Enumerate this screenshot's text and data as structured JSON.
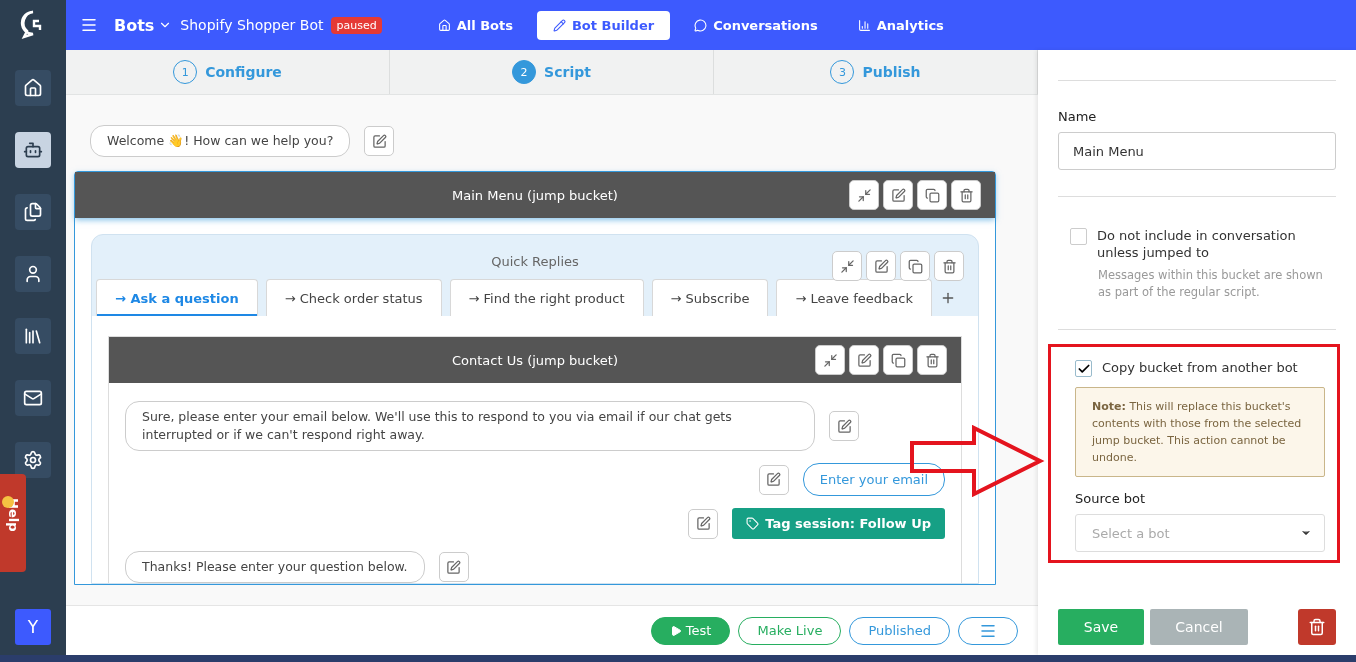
{
  "sidebar": {
    "items": [
      {
        "kind": "home",
        "selected": false
      },
      {
        "kind": "bot",
        "selected": true
      },
      {
        "kind": "pages",
        "selected": false
      },
      {
        "kind": "person",
        "selected": false
      },
      {
        "kind": "books",
        "selected": false
      },
      {
        "kind": "mail",
        "selected": false
      },
      {
        "kind": "settings",
        "selected": false
      }
    ],
    "help": "Help",
    "avatar": "Y"
  },
  "topbar": {
    "section": "Bots",
    "bot_name": "Shopify Shopper Bot",
    "status": "paused",
    "nav": [
      {
        "kind": "home",
        "label": "All Bots",
        "selected": false
      },
      {
        "kind": "pencil",
        "label": "Bot Builder",
        "selected": true
      },
      {
        "kind": "chat",
        "label": "Conversations",
        "selected": false
      },
      {
        "kind": "chart",
        "label": "Analytics",
        "selected": false
      }
    ]
  },
  "steps": [
    {
      "number": "1",
      "label": "Configure",
      "selected": false
    },
    {
      "number": "2",
      "label": "Script",
      "selected": true
    },
    {
      "number": "3",
      "label": "Publish",
      "selected": false
    }
  ],
  "canvas": {
    "welcome": "Welcome 👋! How can we help you?",
    "main_bucket": {
      "title": "Main Menu (jump bucket)",
      "quick_replies": {
        "title": "Quick Replies",
        "tabs": [
          {
            "label": "→ Ask a question",
            "selected": true
          },
          {
            "label": "→ Check order status",
            "selected": false
          },
          {
            "label": "→ Find the right product",
            "selected": false
          },
          {
            "label": "→ Subscribe",
            "selected": false
          },
          {
            "label": "→ Leave feedback",
            "selected": false
          }
        ],
        "bucket": {
          "title": "Contact Us (jump bucket)",
          "messages": [
            {
              "kind": "bot",
              "text": "Sure, please enter your email below. We'll use this to respond to you via email if our chat gets interrupted or if we can't respond right away."
            },
            {
              "kind": "input",
              "text": "Enter your email"
            },
            {
              "kind": "tag",
              "text": "Tag session: Follow Up"
            },
            {
              "kind": "bot",
              "text": "Thanks! Please enter your question below."
            }
          ]
        }
      }
    }
  },
  "footer": {
    "buttons": [
      {
        "kind": "test",
        "label": "Test"
      },
      {
        "kind": "live",
        "label": "Make Live"
      },
      {
        "kind": "published",
        "label": "Published"
      }
    ]
  },
  "panel": {
    "name_label": "Name",
    "name_value": "Main Menu",
    "exclude": {
      "label": "Do not include in conversation unless jumped to",
      "checked": false,
      "hint": "Messages within this bucket are shown as part of the regular script."
    },
    "copy": {
      "label": "Copy bucket from another bot",
      "checked": true,
      "note": "**Note:** This will replace this bucket's contents with those from the selected jump bucket. This action cannot be undone.",
      "source_label": "Source bot",
      "source_placeholder": "Select a bot"
    },
    "buttons": [
      {
        "kind": "save",
        "label": "Save"
      },
      {
        "kind": "cancel",
        "label": "Cancel"
      }
    ]
  }
}
